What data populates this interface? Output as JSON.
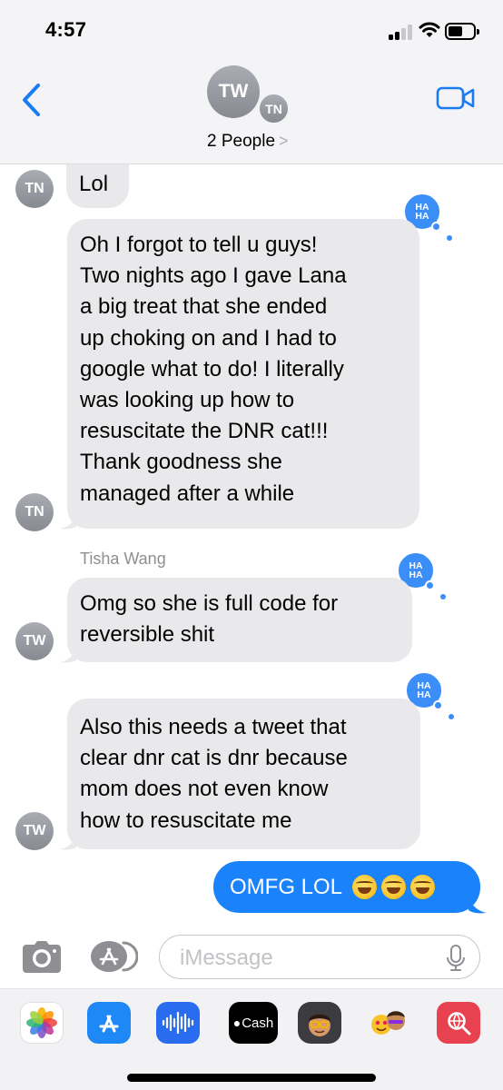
{
  "status_bar": {
    "time": "4:57"
  },
  "header": {
    "primary_avatar_initials": "TW",
    "secondary_avatar_initials": "TN",
    "group_label": "2 People",
    "chevron": ">"
  },
  "messages": [
    {
      "sender_initials": "TN",
      "lines": [
        "Lol"
      ]
    },
    {
      "sender_initials": "TN",
      "lines": [
        "Oh I forgot to tell u guys!",
        "Two nights ago I gave Lana",
        "a big treat that she ended",
        "up choking on and I had to",
        "google what to do! I literally",
        "was looking up how to",
        "resuscitate the DNR cat!!!",
        "Thank goodness she",
        "managed after a while"
      ],
      "tapback": "HA HA"
    },
    {
      "sender_name": "Tisha Wang",
      "sender_initials": "TW",
      "lines": [
        "Omg so she is full code for",
        "reversible shit"
      ],
      "tapback": "HA HA"
    },
    {
      "sender_initials": "TW",
      "lines": [
        "Also this needs a tweet that",
        "clear dnr cat is dnr because",
        "mom does not even know",
        "how to resuscitate me"
      ],
      "tapback": "HA HA"
    },
    {
      "outgoing": true,
      "text": "OMFG LOL",
      "emoji_count": 3,
      "emoji": "rolling-on-floor-laughing"
    }
  ],
  "tapback_label": {
    "top": "HA",
    "bottom": "HA"
  },
  "composer": {
    "placeholder": "iMessage"
  },
  "app_drawer": {
    "apps": [
      {
        "name": "photos-app-icon"
      },
      {
        "name": "app-store-icon"
      },
      {
        "name": "audio-message-icon"
      },
      {
        "name": "apple-cash-icon",
        "label": "Cash"
      },
      {
        "name": "memoji-icon"
      },
      {
        "name": "memoji-stickers-icon"
      },
      {
        "name": "web-search-icon"
      }
    ]
  },
  "colors": {
    "incoming_bubble": "#e9e9eb",
    "outgoing_bubble": "#1a82fb",
    "tapback": "#3b8ef7",
    "ios_blue": "#1a7cf5"
  }
}
